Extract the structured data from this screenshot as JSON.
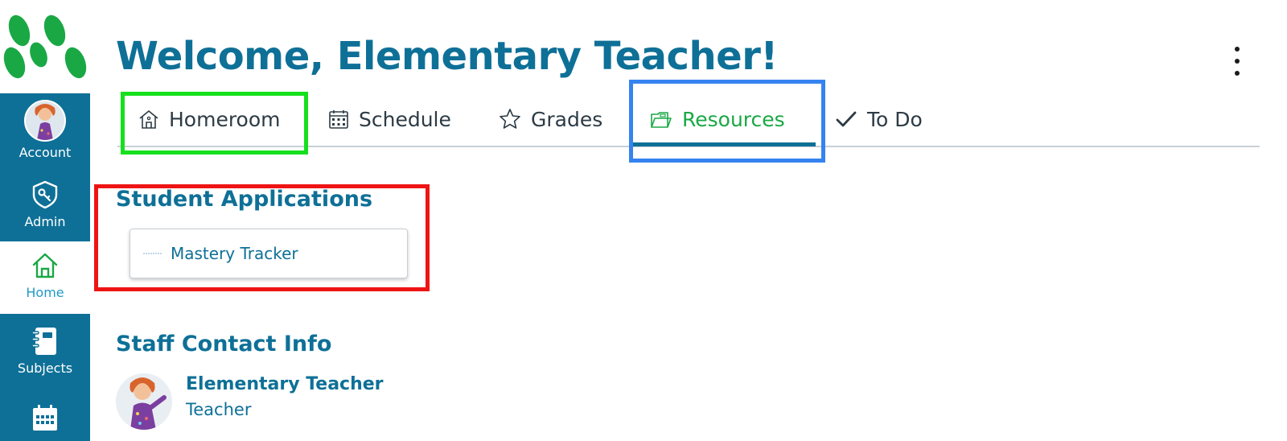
{
  "header": {
    "title": "Welcome, Elementary Teacher!",
    "more_menu_icon": "kebab-menu-icon"
  },
  "sidebar": {
    "items": [
      {
        "label": "Account",
        "icon": "user-avatar"
      },
      {
        "label": "Admin",
        "icon": "shield-key-icon"
      },
      {
        "label": "Home",
        "icon": "home-icon",
        "active": true
      },
      {
        "label": "Subjects",
        "icon": "notebook-icon"
      },
      {
        "label": "",
        "icon": "calendar-icon"
      }
    ]
  },
  "tabs": [
    {
      "label": "Homeroom",
      "icon": "home-icon"
    },
    {
      "label": "Schedule",
      "icon": "calendar-icon"
    },
    {
      "label": "Grades",
      "icon": "star-icon"
    },
    {
      "label": "Resources",
      "icon": "folder-icon",
      "active": true
    },
    {
      "label": "To Do",
      "icon": "checkmark-icon"
    }
  ],
  "student_applications": {
    "title": "Student Applications",
    "apps": [
      {
        "name": "Mastery Tracker"
      }
    ]
  },
  "staff_contact": {
    "title": "Staff Contact Info",
    "contacts": [
      {
        "name": "Elementary Teacher",
        "role": "Teacher"
      }
    ]
  },
  "colors": {
    "brand_blue": "#0e7097",
    "brand_green": "#1aa845",
    "highlight_green": "#16e01e",
    "highlight_blue": "#3583f0",
    "highlight_red": "#ef1414"
  }
}
